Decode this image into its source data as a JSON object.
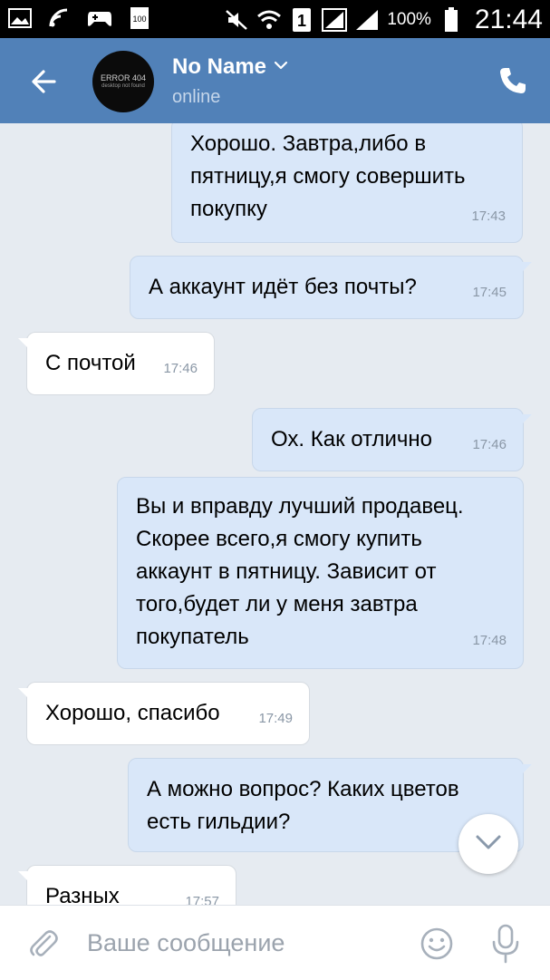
{
  "statusbar": {
    "badge": "100",
    "sim_number": "1",
    "battery_percent": "100%",
    "time": "21:44",
    "icons": [
      "gallery-icon",
      "wifi-icon",
      "gamepad-icon",
      "badge-icon",
      "mute-icon",
      "wifi-icon",
      "sim-icon",
      "signal-icon",
      "signal-icon",
      "battery-icon"
    ]
  },
  "header": {
    "name": "No Name",
    "status": "online",
    "avatar_text": "ERROR 404",
    "avatar_subtext": "desktop not found",
    "accent": "#5181b8"
  },
  "messages": [
    {
      "direction": "out",
      "text": "Хорошо. Завтра,либо в пятницу,я смогу совершить покупку",
      "time": "17:43"
    },
    {
      "direction": "out",
      "text": "А аккаунт идёт без почты?",
      "time": "17:45"
    },
    {
      "direction": "in",
      "text": "С почтой",
      "time": "17:46"
    },
    {
      "direction": "out",
      "text": "Ох. Как отлично",
      "time": "17:46"
    },
    {
      "direction": "out",
      "text": "Вы и вправду лучший продавец. Скорее всего,я смогу купить аккаунт в пятницу. Зависит от того,будет ли у меня завтра покупатель",
      "time": "17:48"
    },
    {
      "direction": "in",
      "text": "Хорошо, спасибо",
      "time": "17:49"
    },
    {
      "direction": "out",
      "text": "А можно вопрос? Каких цветов есть гильдии?",
      "time": ""
    },
    {
      "direction": "in",
      "text": "Разных",
      "time": "17:57"
    }
  ],
  "msg_lines": {
    "m0": [
      "Хорошо. Завтра,либо в",
      "пятницу,я смогу совершить",
      "покупку"
    ],
    "m4": [
      "Вы и вправду лучший продавец.",
      "Скорее всего,я смогу купить",
      "аккаунт в пятницу. Зависит от",
      "того,будет ли у меня завтра",
      "покупатель"
    ],
    "m6": [
      "А можно вопрос? Каких цветов",
      "есть гильдии?"
    ]
  },
  "input": {
    "placeholder": "Ваше сообщение"
  },
  "colors": {
    "outgoing_bubble": "#d9e7f9",
    "incoming_bubble": "#ffffff",
    "chat_background": "#e6ebf1"
  }
}
